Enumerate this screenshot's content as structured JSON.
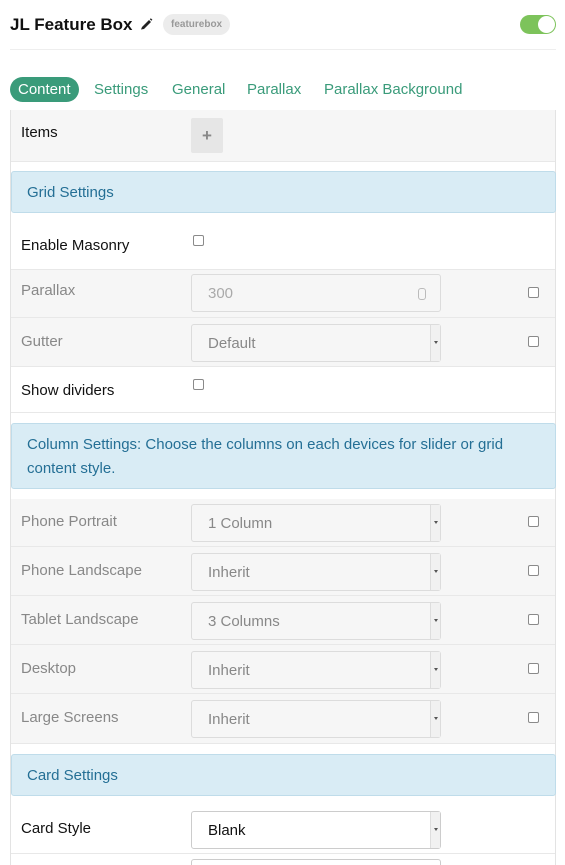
{
  "header": {
    "title": "JL Feature Box",
    "badge": "featurebox",
    "enabled": true,
    "accent_color": "#7dc35b"
  },
  "tabs": [
    {
      "label": "Content",
      "active": true
    },
    {
      "label": "Settings",
      "active": false
    },
    {
      "label": "General",
      "active": false
    },
    {
      "label": "Parallax",
      "active": false
    },
    {
      "label": "Parallax Background",
      "active": false
    }
  ],
  "items": {
    "label": "Items",
    "add_icon": "+"
  },
  "grid_settings": {
    "heading": "Grid Settings",
    "enable_masonry": {
      "label": "Enable Masonry",
      "checked": false
    },
    "parallax": {
      "label": "Parallax",
      "placeholder": "300"
    },
    "gutter": {
      "label": "Gutter",
      "value": "Default"
    },
    "show_dividers": {
      "label": "Show dividers",
      "checked": false
    }
  },
  "column_settings": {
    "heading": "Column Settings: Choose the columns on each devices for slider or grid content style.",
    "rows": [
      {
        "label": "Phone Portrait",
        "value": "1 Column"
      },
      {
        "label": "Phone Landscape",
        "value": "Inherit"
      },
      {
        "label": "Tablet Landscape",
        "value": "3 Columns"
      },
      {
        "label": "Desktop",
        "value": "Inherit"
      },
      {
        "label": "Large Screens",
        "value": "Inherit"
      }
    ]
  },
  "card_settings": {
    "heading": "Card Settings",
    "card_style": {
      "label": "Card Style",
      "value": "Blank"
    }
  },
  "colors": {
    "tab_accent": "#3a9b7a",
    "section_bg": "#d9ecf5",
    "section_text": "#246f95"
  }
}
